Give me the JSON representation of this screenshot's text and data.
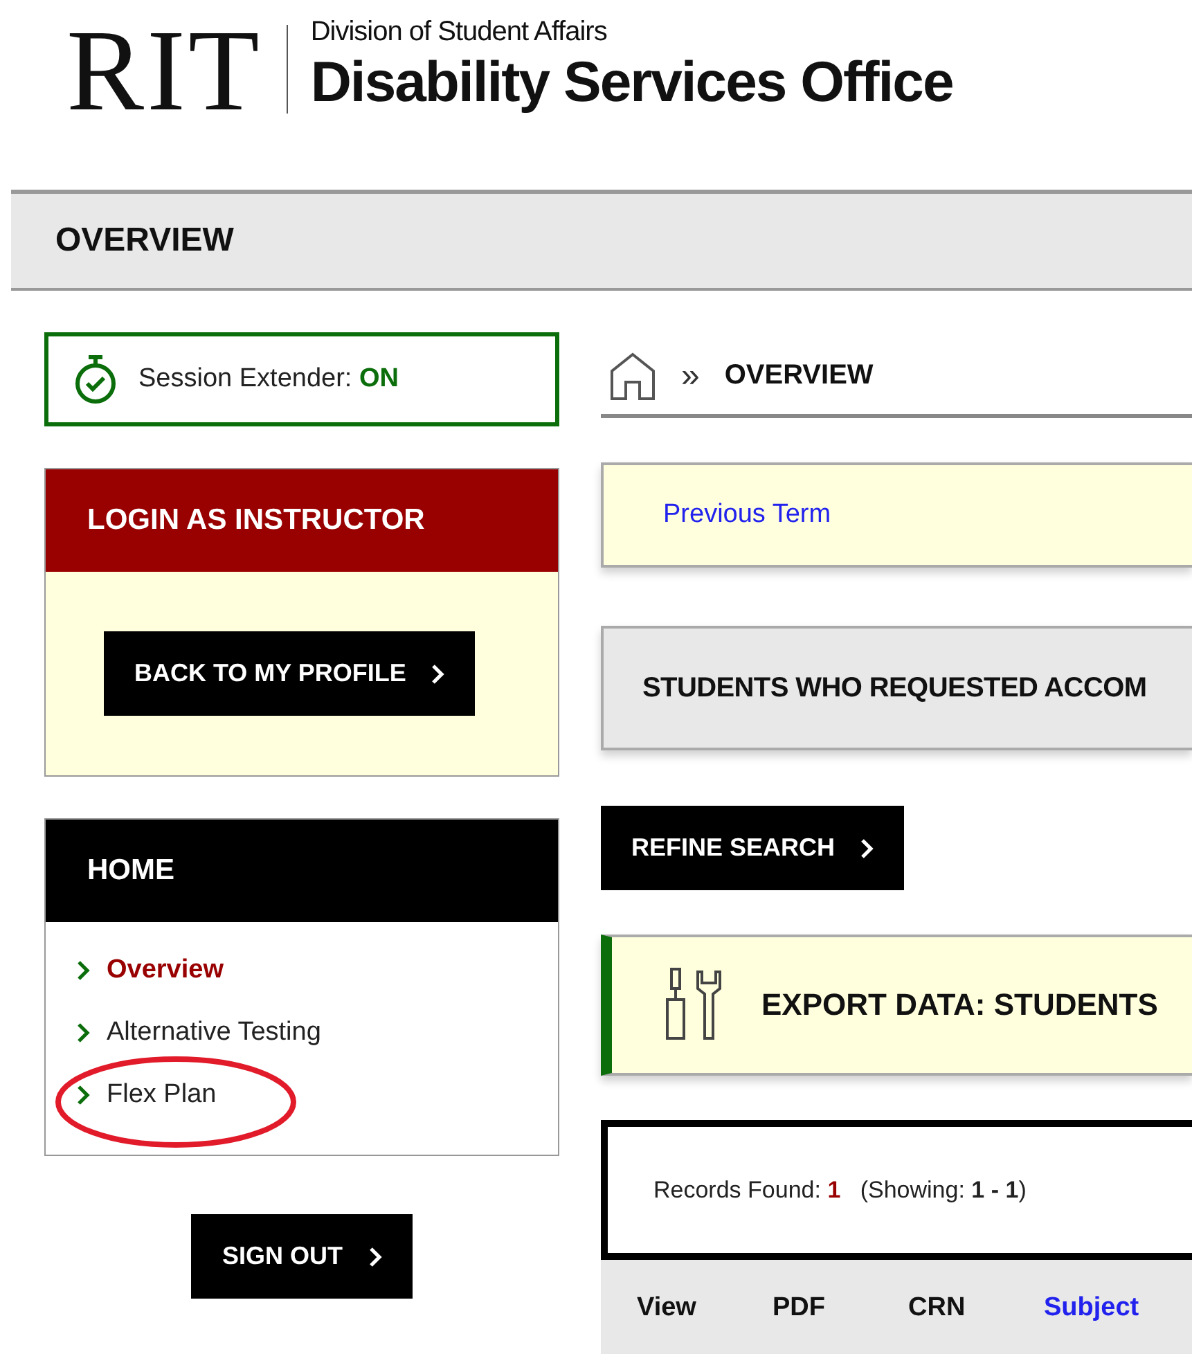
{
  "header": {
    "logo": "RIT",
    "division": "Division of Student Affairs",
    "office": "Disability Services Office"
  },
  "page_title": "OVERVIEW",
  "session": {
    "label": "Session Extender: ",
    "state": "ON",
    "on": true
  },
  "login_panel": {
    "title": "LOGIN AS INSTRUCTOR",
    "button": "BACK TO MY PROFILE"
  },
  "home_panel": {
    "title": "HOME",
    "items": [
      {
        "label": "Overview",
        "selected": true,
        "circled": false
      },
      {
        "label": "Alternative Testing",
        "selected": false,
        "circled": false
      },
      {
        "label": "Flex Plan",
        "selected": false,
        "circled": true
      }
    ]
  },
  "sign_out": "SIGN OUT",
  "breadcrumb": {
    "separator": "»",
    "current": "OVERVIEW"
  },
  "previous_term": "Previous Term",
  "students_heading": "STUDENTS WHO REQUESTED ACCOM",
  "refine_button": "REFINE SEARCH",
  "export_heading": "EXPORT DATA: STUDENTS",
  "records": {
    "label": "Records Found: ",
    "count": "1",
    "showing_label": "(Showing: ",
    "range": "1 - 1",
    "close": ")"
  },
  "table": {
    "columns": [
      {
        "label": "View",
        "sortable": false
      },
      {
        "label": "PDF",
        "sortable": false
      },
      {
        "label": "CRN",
        "sortable": false
      },
      {
        "label": "Subject",
        "sortable": true
      }
    ]
  }
}
